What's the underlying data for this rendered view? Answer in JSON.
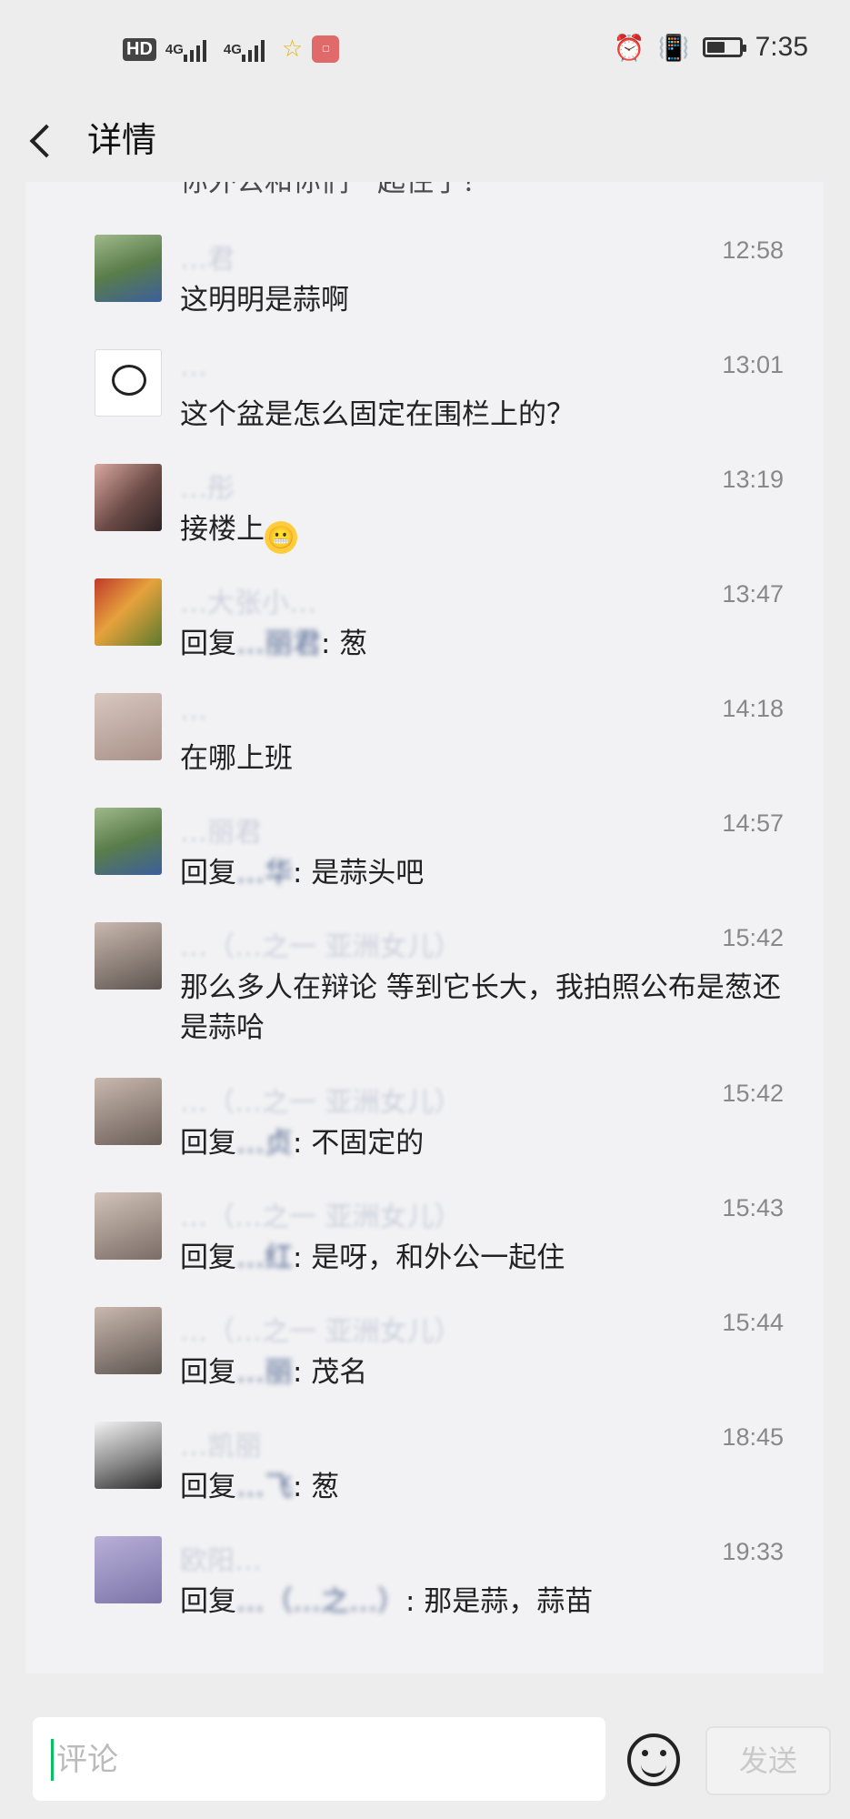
{
  "status_bar": {
    "hd": "HD",
    "net1": "4G",
    "net2": "4G",
    "time": "7:35",
    "battery_level": 0.55
  },
  "header": {
    "title": "详情"
  },
  "top_partial_text": "你外公和你们一起住了？",
  "comments": [
    {
      "name": "…君",
      "time": "12:58",
      "text": "这明明是蒜啊"
    },
    {
      "name": "…",
      "time": "13:01",
      "text": "这个盆是怎么固定在围栏上的？"
    },
    {
      "name": "…彤",
      "time": "13:19",
      "text": "接楼上"
    },
    {
      "name": "…大张小…",
      "time": "13:47",
      "reply_prefix": "回复",
      "reply_to": "…丽君",
      "text": ": 葱"
    },
    {
      "name": "…",
      "time": "14:18",
      "text": "在哪上班"
    },
    {
      "name": "…丽君",
      "time": "14:57",
      "reply_prefix": "回复",
      "reply_to": "…华",
      "text": ": 是蒜头吧"
    },
    {
      "name": "…（…之一 亚洲女儿）",
      "time": "15:42",
      "text": "那么多人在辩论 等到它长大，我拍照公布是葱还是蒜哈"
    },
    {
      "name": "…（…之一 亚洲女儿）",
      "time": "15:42",
      "reply_prefix": "回复",
      "reply_to": "…贞",
      "text": ": 不固定的"
    },
    {
      "name": "…（…之一 亚洲女儿）",
      "time": "15:43",
      "reply_prefix": "回复",
      "reply_to": "…红",
      "text": ": 是呀，和外公一起住"
    },
    {
      "name": "…（…之一 亚洲女儿）",
      "time": "15:44",
      "reply_prefix": "回复",
      "reply_to": "…丽",
      "text": ": 茂名"
    },
    {
      "name": "…凯丽",
      "time": "18:45",
      "reply_prefix": "回复",
      "reply_to": "…飞",
      "text": ": 葱"
    },
    {
      "name": "欧阳…",
      "time": "19:33",
      "reply_prefix": "回复",
      "reply_to": "…（…之…）",
      "text": ": 那是蒜，蒜苗"
    }
  ],
  "input": {
    "placeholder": "评论",
    "send_label": "发送"
  }
}
